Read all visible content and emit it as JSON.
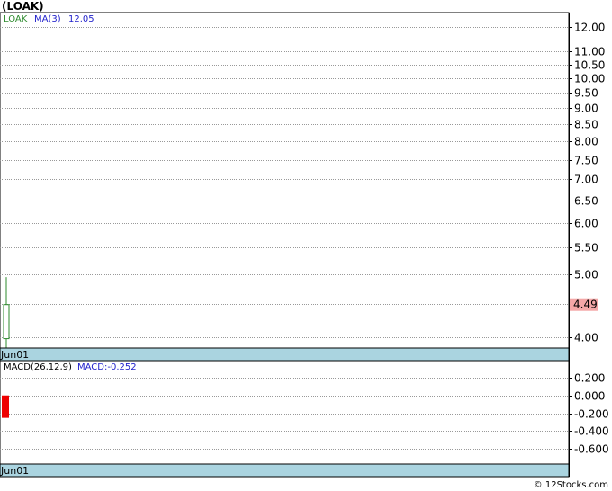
{
  "title": "(LOAK)",
  "footer": "© 12Stocks.com",
  "colors": {
    "ticker": "#2e8b2e",
    "ma": "#2222cc",
    "macd": "#2222cc",
    "candle_up": "#2e8b2e",
    "macd_bar": "#ee0000",
    "price_badge": "#f4a7a7",
    "axis_band": "#aad4e0"
  },
  "chart_data": [
    {
      "type": "candlestick",
      "name": "price",
      "ticker": "LOAK",
      "ma_label": "MA(3)",
      "ma_value": "12.05",
      "last_price_label": "4.49",
      "last_price": 4.49,
      "x_label": "Jun01",
      "ylim": [
        3.8,
        12.5
      ],
      "y_ticks": [
        12.0,
        11.0,
        10.5,
        10.0,
        9.5,
        9.0,
        8.5,
        8.0,
        7.5,
        7.0,
        6.5,
        6.0,
        5.5,
        5.0,
        4.5,
        4.0
      ],
      "y_tick_labels": [
        "12.00",
        "11.00",
        "10.50",
        "10.00",
        "9.50",
        "9.00",
        "8.50",
        "8.00",
        "7.50",
        "7.00",
        "6.50",
        "6.00",
        "5.50",
        "5.00",
        "4.50",
        "4.00"
      ],
      "candles": [
        {
          "date": "Jun01",
          "open": 3.98,
          "high": 4.95,
          "low": 3.85,
          "close": 4.49
        }
      ],
      "grid": true
    },
    {
      "type": "bar",
      "name": "macd",
      "indicator_label": "MACD(26,12,9)",
      "value_label": "MACD:-0.252",
      "x_label": "Jun01",
      "ylim": [
        -0.75,
        0.32
      ],
      "y_ticks": [
        0.2,
        0.0,
        -0.2,
        -0.4,
        -0.6
      ],
      "y_tick_labels": [
        "0.200",
        "0.000",
        "-0.200",
        "-0.400",
        "-0.600"
      ],
      "bars": [
        {
          "date": "Jun01",
          "value": -0.252
        }
      ],
      "grid": true
    }
  ]
}
